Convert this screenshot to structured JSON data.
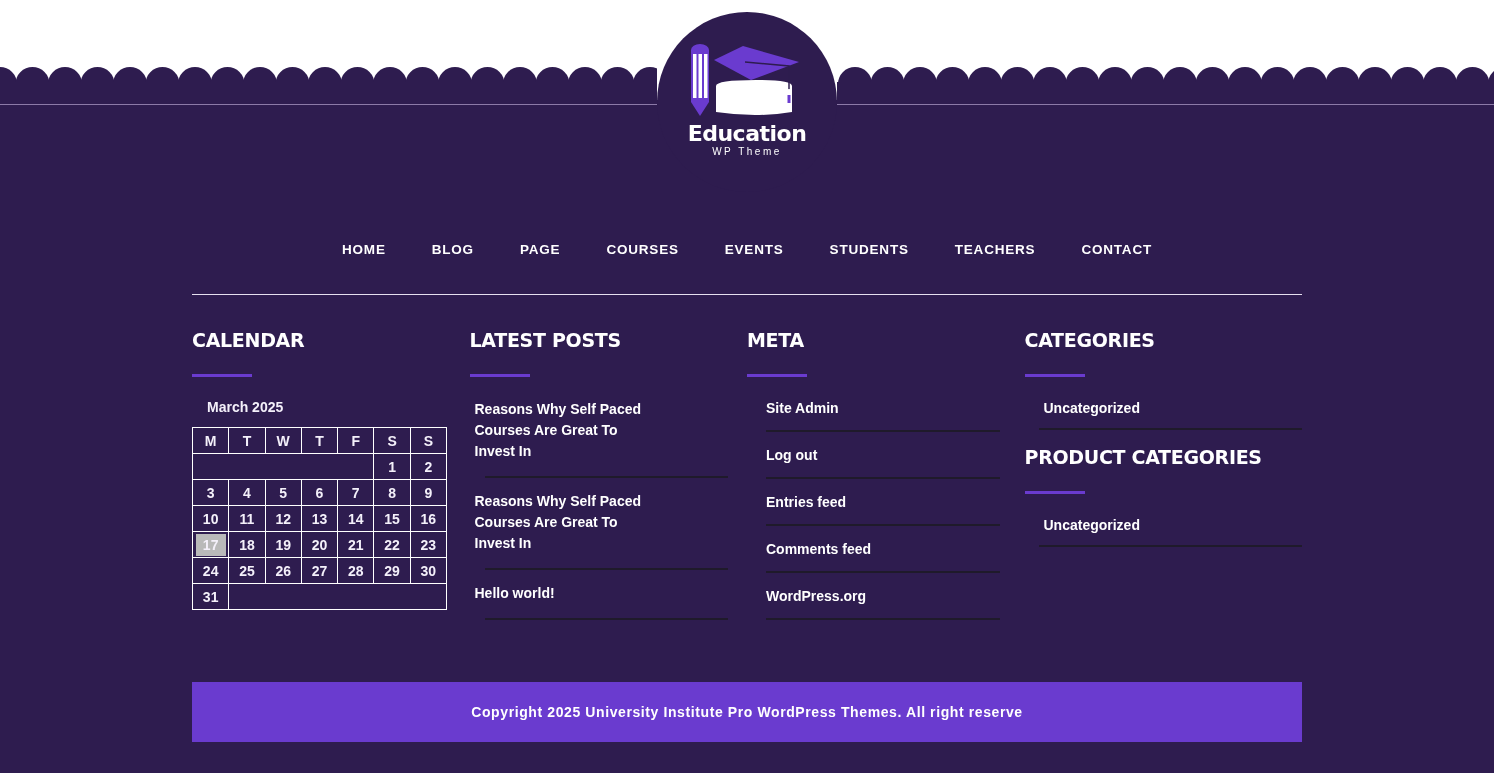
{
  "logo": {
    "title": "Education",
    "subtitle": "WP Theme"
  },
  "nav": [
    "HOME",
    "BLOG",
    "PAGE",
    "COURSES",
    "EVENTS",
    "STUDENTS",
    "TEACHERS",
    "CONTACT"
  ],
  "calendar": {
    "heading": "CALENDAR",
    "month": "March 2025",
    "weekdays": [
      "M",
      "T",
      "W",
      "T",
      "F",
      "S",
      "S"
    ],
    "weeks": [
      [
        {
          "day": "1",
          "today": false
        },
        {
          "day": "2",
          "today": false
        }
      ],
      [
        {
          "day": "3",
          "today": false
        },
        {
          "day": "4",
          "today": false
        },
        {
          "day": "5",
          "today": false
        },
        {
          "day": "6",
          "today": false
        },
        {
          "day": "7",
          "today": false
        },
        {
          "day": "8",
          "today": false
        },
        {
          "day": "9",
          "today": false
        }
      ],
      [
        {
          "day": "10",
          "today": false
        },
        {
          "day": "11",
          "today": false
        },
        {
          "day": "12",
          "today": false
        },
        {
          "day": "13",
          "today": false
        },
        {
          "day": "14",
          "today": false
        },
        {
          "day": "15",
          "today": false
        },
        {
          "day": "16",
          "today": false
        }
      ],
      [
        {
          "day": "17",
          "today": true
        },
        {
          "day": "18",
          "today": false
        },
        {
          "day": "19",
          "today": false
        },
        {
          "day": "20",
          "today": false
        },
        {
          "day": "21",
          "today": false
        },
        {
          "day": "22",
          "today": false
        },
        {
          "day": "23",
          "today": false
        }
      ],
      [
        {
          "day": "24",
          "today": false
        },
        {
          "day": "25",
          "today": false
        },
        {
          "day": "26",
          "today": false
        },
        {
          "day": "27",
          "today": false
        },
        {
          "day": "28",
          "today": false
        },
        {
          "day": "29",
          "today": false
        },
        {
          "day": "30",
          "today": false
        }
      ],
      [
        {
          "day": "31",
          "today": false
        }
      ]
    ]
  },
  "latest_posts": {
    "heading": "LATEST POSTS",
    "items": [
      "Reasons Why Self Paced Courses Are Great To Invest In",
      "Reasons Why Self Paced Courses Are Great To Invest In",
      "Hello world!"
    ]
  },
  "meta": {
    "heading": "META",
    "items": [
      "Site Admin",
      "Log out",
      "Entries feed",
      "Comments feed",
      "WordPress.org"
    ]
  },
  "categories": {
    "heading": "CATEGORIES",
    "items": [
      "Uncategorized"
    ]
  },
  "product_categories": {
    "heading": "PRODUCT CATEGORIES",
    "items": [
      "Uncategorized"
    ]
  },
  "footer": {
    "copyright": "Copyright 2025 University Institute Pro WordPress Themes. All right reserve"
  }
}
